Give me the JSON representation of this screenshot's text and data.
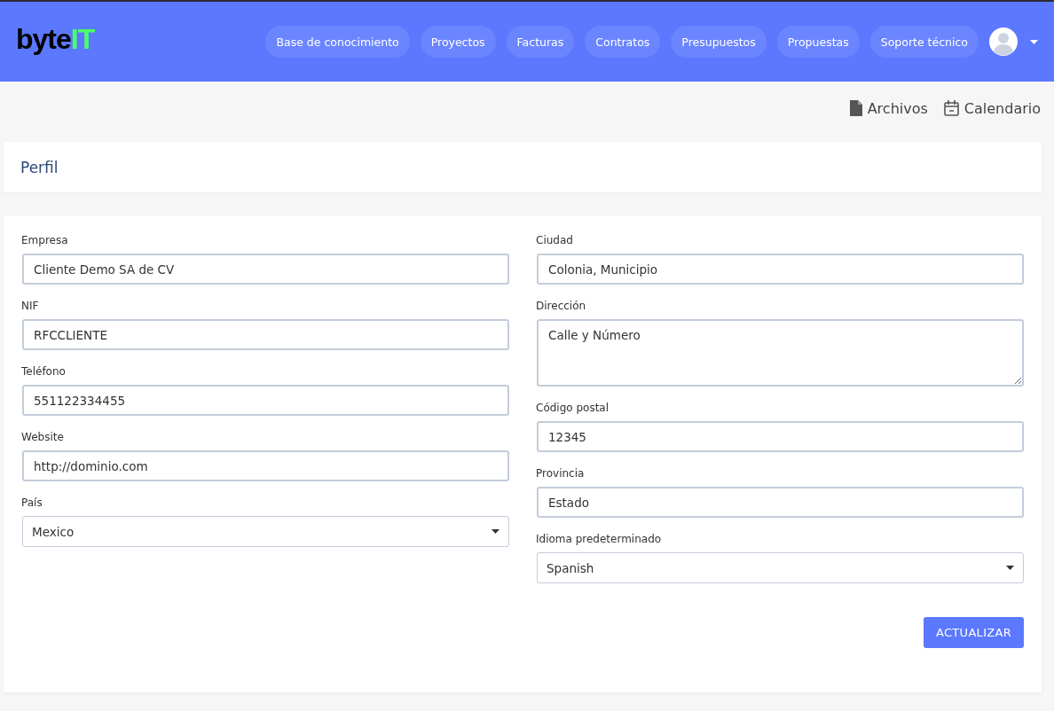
{
  "header": {
    "logo": {
      "prefix": "byte",
      "suffix": "IT"
    },
    "nav": [
      {
        "label": "Base de conocimiento"
      },
      {
        "label": "Proyectos"
      },
      {
        "label": "Facturas"
      },
      {
        "label": "Contratos"
      },
      {
        "label": "Presupuestos"
      },
      {
        "label": "Propuestas"
      },
      {
        "label": "Soporte técnico"
      }
    ]
  },
  "toolbar": [
    {
      "kind": "file",
      "label": "Archivos"
    },
    {
      "kind": "calendar",
      "label": "Calendario"
    }
  ],
  "page_title": "Perfil",
  "form": {
    "columns": [
      [
        {
          "kind": "text",
          "label": "Empresa",
          "value": "Cliente Demo SA de CV"
        },
        {
          "kind": "text",
          "label": "NIF",
          "value": "RFCCLIENTE"
        },
        {
          "kind": "text",
          "label": "Teléfono",
          "value": "551122334455"
        },
        {
          "kind": "text",
          "label": "Website",
          "value": "http://dominio.com"
        },
        {
          "kind": "select",
          "label": "País",
          "value": "Mexico"
        }
      ],
      [
        {
          "kind": "text",
          "label": "Ciudad",
          "value": "Colonia, Municipio"
        },
        {
          "kind": "textarea",
          "label": "Dirección",
          "value": "Calle y Número"
        },
        {
          "kind": "text",
          "label": "Código postal",
          "value": "12345"
        },
        {
          "kind": "text",
          "label": "Provincia",
          "value": "Estado"
        },
        {
          "kind": "select",
          "label": "Idioma predeterminado",
          "value": "Spanish"
        }
      ]
    ],
    "submit": "ACTUALIZAR"
  }
}
